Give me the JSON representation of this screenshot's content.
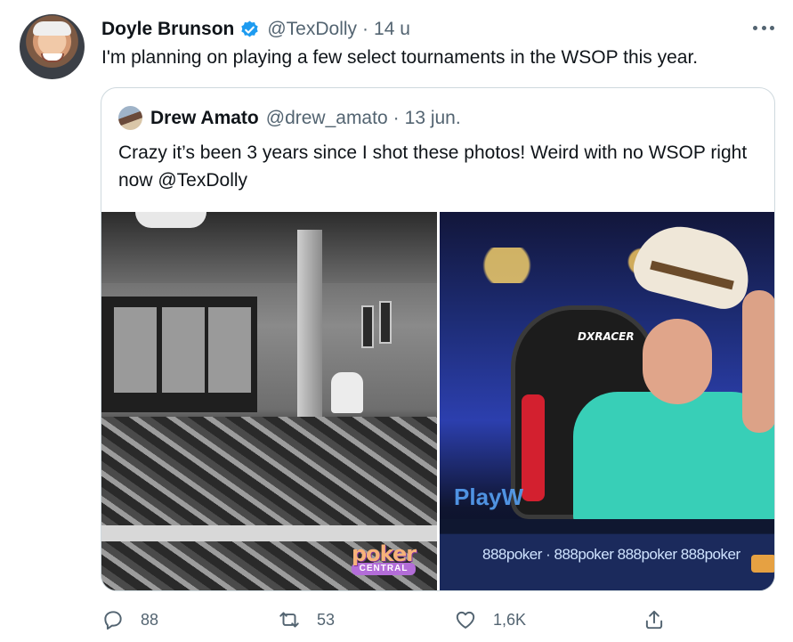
{
  "tweet": {
    "author_name": "Doyle Brunson",
    "handle": "@TexDolly",
    "separator": "·",
    "time": "14 u",
    "text": "I'm planning on playing a few select tournaments in the WSOP this year."
  },
  "quoted": {
    "author_name": "Drew Amato",
    "handle": "@drew_amato",
    "separator": "·",
    "time": "13 jun.",
    "text": "Crazy it’s been 3 years since I shot these photos! Weird with no WSOP right now  @TexDolly"
  },
  "media": {
    "left_logo_top": "poker",
    "left_logo_bottom": "CENTRAL",
    "right_chair_brand": "DXRACER",
    "right_banner": "PlayW",
    "right_rail": "888poker  ·  888poker 888poker 888poker"
  },
  "actions": {
    "reply_count": "88",
    "retweet_count": "53",
    "like_count": "1,6K"
  },
  "colors": {
    "accent": "#1d9bf0",
    "secondary_text": "#536471",
    "border": "#cfd9de"
  },
  "icons": [
    "verified-icon",
    "more-icon",
    "reply-icon",
    "retweet-icon",
    "like-icon",
    "share-icon"
  ]
}
